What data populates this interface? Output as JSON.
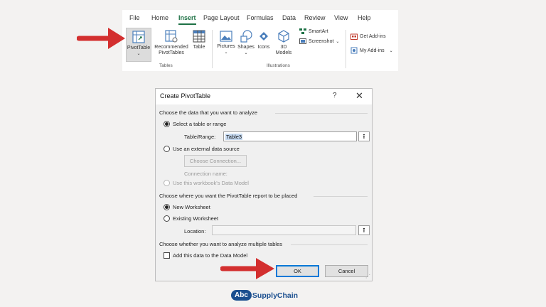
{
  "ribbon": {
    "tabs": [
      "File",
      "Home",
      "Insert",
      "Page Layout",
      "Formulas",
      "Data",
      "Review",
      "View",
      "Help"
    ],
    "active_tab": "Insert",
    "pivot_table": "PivotTable",
    "recommended_line1": "Recommended",
    "recommended_line2": "PivotTables",
    "table": "Table",
    "tables_group": "Tables",
    "pictures": "Pictures",
    "shapes": "Shapes",
    "icons": "Icons",
    "models_line1": "3D",
    "models_line2": "Models",
    "smartart": "SmartArt",
    "screenshot": "Screenshot",
    "illustrations_group": "Illustrations",
    "get_addins": "Get Add-ins",
    "my_addins": "My Add-ins"
  },
  "dialog": {
    "title": "Create PivotTable",
    "help": "?",
    "close": "✕",
    "section1": "Choose the data that you want to analyze",
    "opt_table_range": "Select a table or range",
    "table_range_label": "Table/Range:",
    "table_range_value": "Table3",
    "opt_external": "Use an external data source",
    "choose_connection": "Choose Connection...",
    "connection_name": "Connection name:",
    "opt_data_model": "Use this workbook's Data Model",
    "section2": "Choose where you want the PivotTable report to be placed",
    "opt_new_ws": "New Worksheet",
    "opt_existing_ws": "Existing Worksheet",
    "location_label": "Location:",
    "location_value": "",
    "section3": "Choose whether you want to analyze multiple tables",
    "add_data_model": "Add this data to the Data Model",
    "ok": "OK",
    "cancel": "Cancel"
  },
  "logo": {
    "abc": "Abc",
    "rest": "SupplyChain"
  },
  "colors": {
    "accent_green": "#1e7145",
    "arrow_red": "#d32f2f",
    "ok_border": "#0078d7",
    "logo_blue": "#1b4f8f"
  }
}
